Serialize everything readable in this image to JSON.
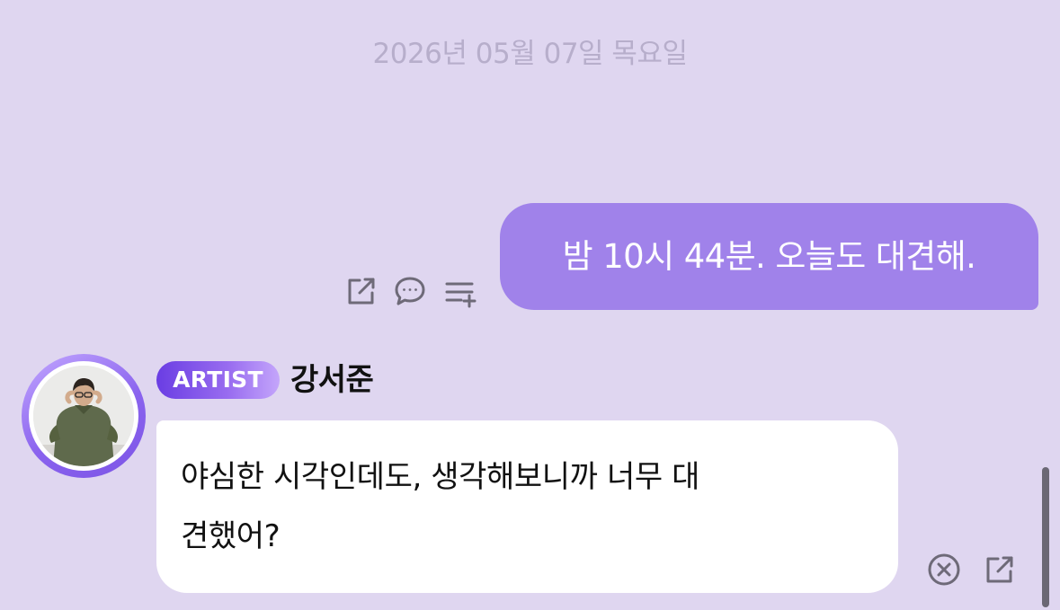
{
  "chat": {
    "date_separator": "2026년 05월 07일 목요일",
    "sent_message": {
      "text": "밤 10시 44분. 오늘도 대견해.",
      "bubble_color": "#a082ea",
      "actions": [
        "share-icon",
        "comment-icon",
        "add-to-list-icon"
      ]
    },
    "received_message": {
      "badge": "ARTIST",
      "sender_name": "강서준",
      "text": "야심한 시각인데도, 생각해보니까 너무 대\n견했어?",
      "actions": [
        "close-circle-icon",
        "share-icon"
      ]
    }
  },
  "colors": {
    "background": "#dfd6f0",
    "accent": "#7c55e6",
    "date_text": "#b7aecb"
  }
}
